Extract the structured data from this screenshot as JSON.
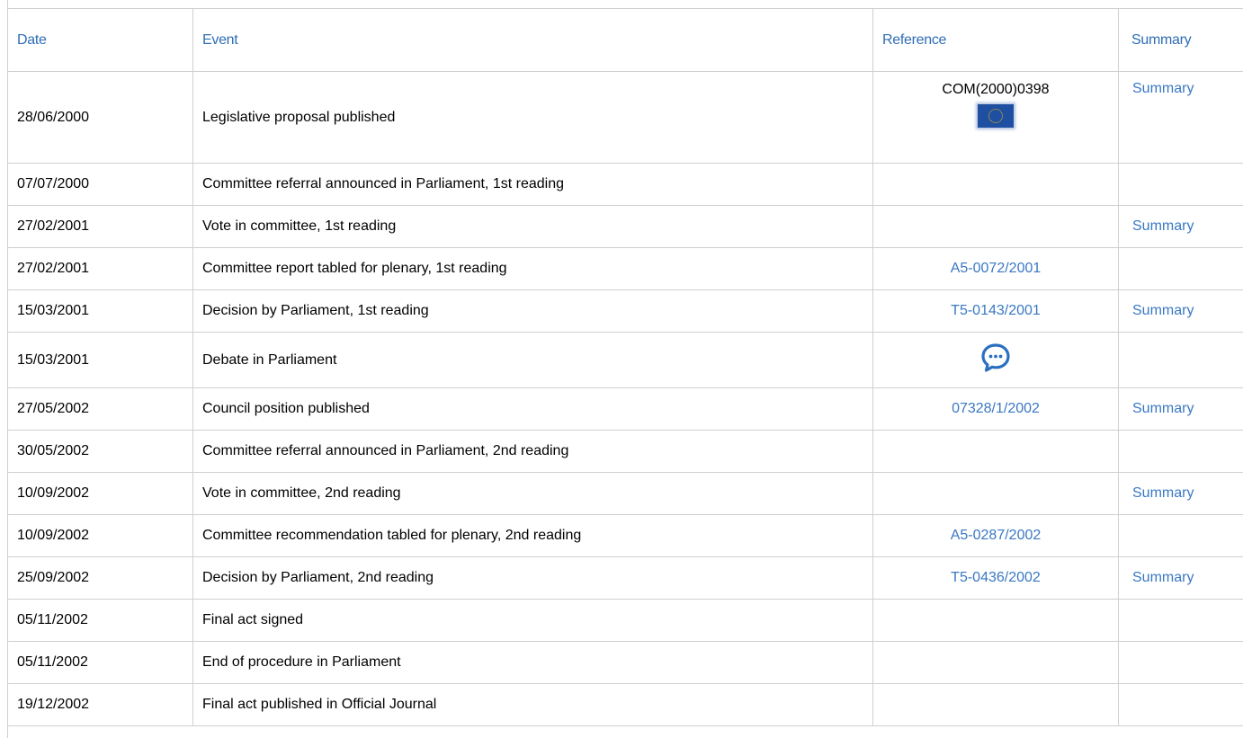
{
  "table": {
    "headers": {
      "date": "Date",
      "event": "Event",
      "reference": "Reference",
      "summary": "Summary"
    },
    "rows": [
      {
        "date": "28/06/2000",
        "event": "Legislative proposal published",
        "reference": "COM(2000)0398",
        "summary": "Summary"
      },
      {
        "date": "07/07/2000",
        "event": "Committee referral announced in Parliament, 1st reading",
        "reference": "",
        "summary": ""
      },
      {
        "date": "27/02/2001",
        "event": "Vote in committee, 1st reading",
        "reference": "",
        "summary": "Summary"
      },
      {
        "date": "27/02/2001",
        "event": "Committee report tabled for plenary, 1st reading",
        "reference": "A5-0072/2001",
        "summary": ""
      },
      {
        "date": "15/03/2001",
        "event": "Decision by Parliament, 1st reading",
        "reference": "T5-0143/2001",
        "summary": "Summary"
      },
      {
        "date": "15/03/2001",
        "event": "Debate in Parliament",
        "reference": "",
        "summary": ""
      },
      {
        "date": "27/05/2002",
        "event": "Council position published",
        "reference": "07328/1/2002",
        "summary": "Summary"
      },
      {
        "date": "30/05/2002",
        "event": "Committee referral announced in Parliament, 2nd reading",
        "reference": "",
        "summary": ""
      },
      {
        "date": "10/09/2002",
        "event": "Vote in committee, 2nd reading",
        "reference": "",
        "summary": "Summary"
      },
      {
        "date": "10/09/2002",
        "event": "Committee recommendation tabled for plenary, 2nd reading",
        "reference": "A5-0287/2002",
        "summary": ""
      },
      {
        "date": "25/09/2002",
        "event": "Decision by Parliament, 2nd reading",
        "reference": "T5-0436/2002",
        "summary": "Summary"
      },
      {
        "date": "05/11/2002",
        "event": "Final act signed",
        "reference": "",
        "summary": ""
      },
      {
        "date": "05/11/2002",
        "event": "End of procedure in Parliament",
        "reference": "",
        "summary": ""
      },
      {
        "date": "19/12/2002",
        "event": "Final act published in Official Journal",
        "reference": "",
        "summary": ""
      }
    ]
  },
  "icons": {
    "eu_flag": "eu-flag-icon",
    "debate": "speech-bubble-icon"
  },
  "colors": {
    "link": "#3a78c3",
    "header_text": "#2e6db4",
    "border": "#cfcfcf",
    "flag_blue": "#1f4fa0",
    "flag_star": "#f2c200",
    "debate_icon": "#2b6fc0"
  }
}
